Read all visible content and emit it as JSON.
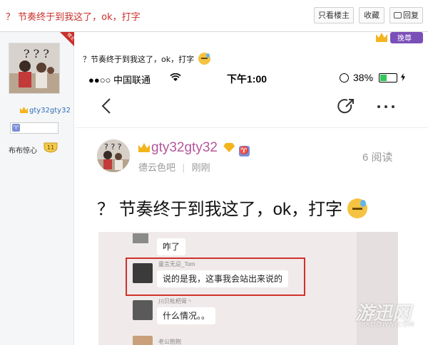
{
  "post": {
    "title": "？ 节奏终于到我这了，ok，打字",
    "content_text": "？节奏终于到我这了，ok，打字"
  },
  "toolbar": {
    "only_op": "只看楼主",
    "favorite": "收藏",
    "reply": "回复"
  },
  "author": {
    "op_tag": "楼主",
    "name": "gty32gty32",
    "level_name": "布布惊心",
    "level": "11"
  },
  "vip": {
    "label": "挽尊"
  },
  "phone": {
    "carrier": "●●○○ 中国联通",
    "time": "下午1:00",
    "battery": "38%",
    "user": "gty32gty32",
    "forum": "德云色吧",
    "time_ago": "刚刚",
    "views": "6 阅读",
    "post_text": "？ 节奏终于到我这了，ok，打字"
  },
  "chat": {
    "msg1": "咋了",
    "sender2": "童言无忌_Tom",
    "msg2": "说的是我，这事我会站出来说的",
    "sender3": "川贝枇杷膏丶",
    "msg3": "什么情况。。",
    "sender4": "老公抱抱"
  },
  "watermark": {
    "text": "游迅网",
    "sub": "YXDOWN.COM"
  },
  "colors": {
    "accent_red": "#c8302a",
    "link_blue": "#2f6fb4",
    "vip_purple": "#7b4fb8",
    "gold": "#f2b51c"
  }
}
